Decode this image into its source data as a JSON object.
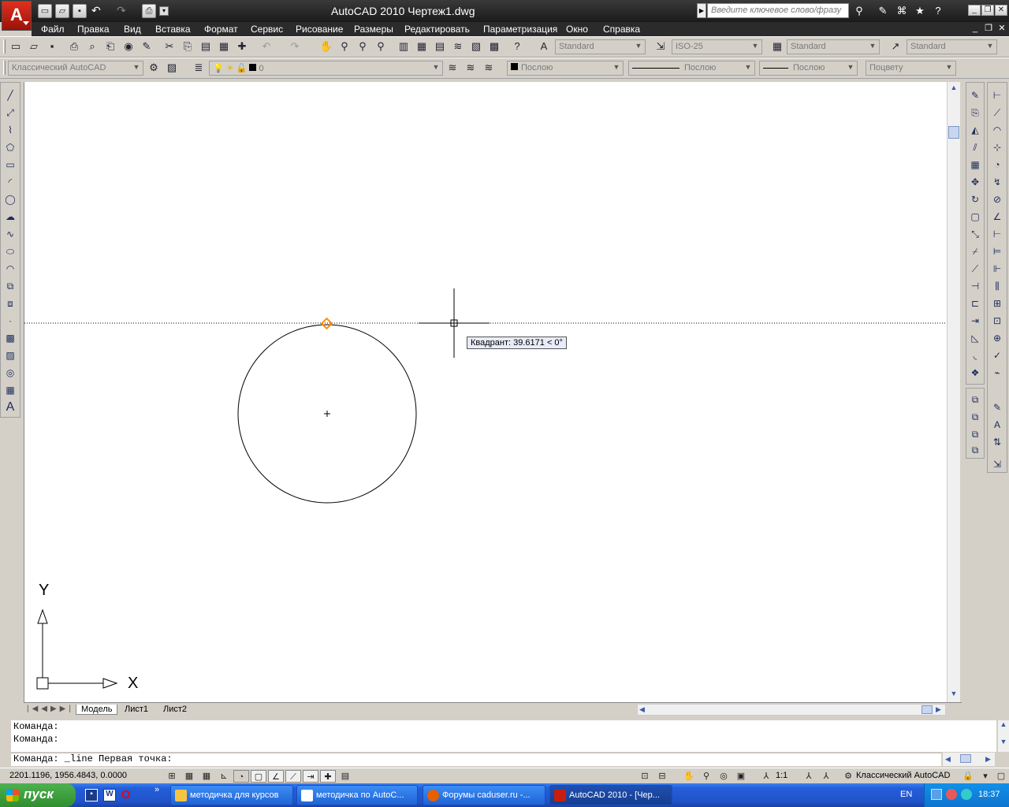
{
  "window": {
    "title": "AutoCAD 2010    Чертеж1.dwg",
    "search_placeholder": "Введите ключевое слово/фразу"
  },
  "menu": [
    "Файл",
    "Правка",
    "Вид",
    "Вставка",
    "Формат",
    "Сервис",
    "Рисование",
    "Размеры",
    "Редактировать",
    "Параметризация",
    "Окно",
    "Справка"
  ],
  "styles_toolbar": {
    "text_style": "Standard",
    "dim_style": "ISO-25",
    "table_style": "Standard",
    "mleader_style": "Standard"
  },
  "layers_toolbar": {
    "workspace": "Классический AutoCAD",
    "layer": "0",
    "color": "Послою",
    "linetype": "Послою",
    "lineweight": "Послою",
    "plotstyle": "Поцвету"
  },
  "drawing": {
    "tooltip": "Квадрант: 39.6171 < 0°",
    "ucs_x": "X",
    "ucs_y": "Y"
  },
  "tabs": [
    "Модель",
    "Лист1",
    "Лист2"
  ],
  "command": {
    "history": [
      "Команда:",
      "Команда:"
    ],
    "current": "Команда: _line Первая точка:"
  },
  "status": {
    "coords": "2201.1196, 1956.4843, 0.0000",
    "scale": "1:1",
    "workspace": "Классический AutoCAD"
  },
  "taskbar": {
    "start": "пуск",
    "tasks": [
      "методичка для курсов",
      "методичка по AutoC...",
      "Форумы caduser.ru -...",
      "AutoCAD 2010 - [Чер..."
    ],
    "lang": "EN",
    "time": "18:37"
  },
  "colors": {
    "title_bg": "#2b2b2b",
    "canvas_bg": "#ffffff",
    "snap_marker": "#ff8c00",
    "taskbar": "#245edb"
  }
}
